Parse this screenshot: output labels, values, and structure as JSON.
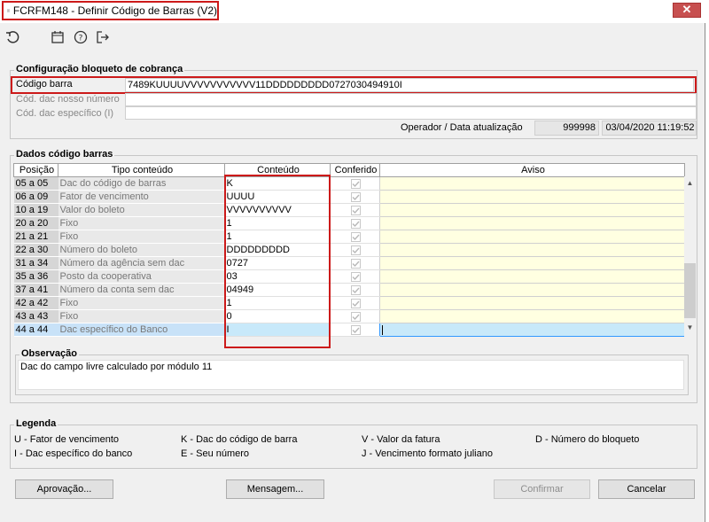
{
  "window": {
    "title": "FCRFM148 - Definir Código de Barras (V2)",
    "close_glyph": "✕"
  },
  "toolbar": {
    "icons": [
      "undo-icon",
      "calendar-icon",
      "help-icon",
      "exit-icon"
    ]
  },
  "config": {
    "group_title": "Configuração bloqueto de cobrança",
    "codigo_barra_label": "Código barra",
    "codigo_barra_value": "7489KUUUUVVVVVVVVVVV11DDDDDDDDD0727030494910I",
    "dac_nosso_label": "Cód. dac nosso número",
    "dac_nosso_value": "",
    "dac_especifico_label": "Cód. dac específico (I)",
    "dac_especifico_value": "",
    "operador_label": "Operador / Data atualização",
    "operador_value": "999998",
    "data_value": "03/04/2020 11:19:52"
  },
  "dados": {
    "group_title": "Dados código barras",
    "headers": [
      "Posição",
      "Tipo conteúdo",
      "Conteúdo",
      "Conferido",
      "Aviso"
    ],
    "rows": [
      {
        "pos": "05 a 05",
        "tipo": "Dac do código de barras",
        "cont": "K"
      },
      {
        "pos": "06 a 09",
        "tipo": "Fator de vencimento",
        "cont": "UUUU"
      },
      {
        "pos": "10 a 19",
        "tipo": "Valor do boleto",
        "cont": "VVVVVVVVVV"
      },
      {
        "pos": "20 a 20",
        "tipo": "Fixo",
        "cont": "1"
      },
      {
        "pos": "21 a 21",
        "tipo": "Fixo",
        "cont": "1"
      },
      {
        "pos": "22 a 30",
        "tipo": "Número do boleto",
        "cont": "DDDDDDDDD"
      },
      {
        "pos": "31 a 34",
        "tipo": "Número da agência sem dac",
        "cont": "0727"
      },
      {
        "pos": "35 a 36",
        "tipo": "Posto da cooperativa",
        "cont": "03"
      },
      {
        "pos": "37 a 41",
        "tipo": "Número da conta sem dac",
        "cont": "04949"
      },
      {
        "pos": "42 a 42",
        "tipo": "Fixo",
        "cont": "1"
      },
      {
        "pos": "43 a 43",
        "tipo": "Fixo",
        "cont": "0"
      },
      {
        "pos": "44 a 44",
        "tipo": "Dac específico do Banco",
        "cont": "I"
      }
    ],
    "observacao_title": "Observação",
    "observacao_text": "Dac do campo livre calculado por módulo 11"
  },
  "legenda": {
    "title": "Legenda",
    "items": [
      "U - Fator de vencimento",
      "K - Dac do código de barra",
      "V - Valor da fatura",
      "D - Número do bloqueto",
      "I - Dac específico do banco",
      "E - Seu número",
      "J - Vencimento formato juliano"
    ]
  },
  "buttons": {
    "aprovacao": "Aprovação...",
    "mensagem": "Mensagem...",
    "confirmar": "Confirmar",
    "cancelar": "Cancelar"
  }
}
